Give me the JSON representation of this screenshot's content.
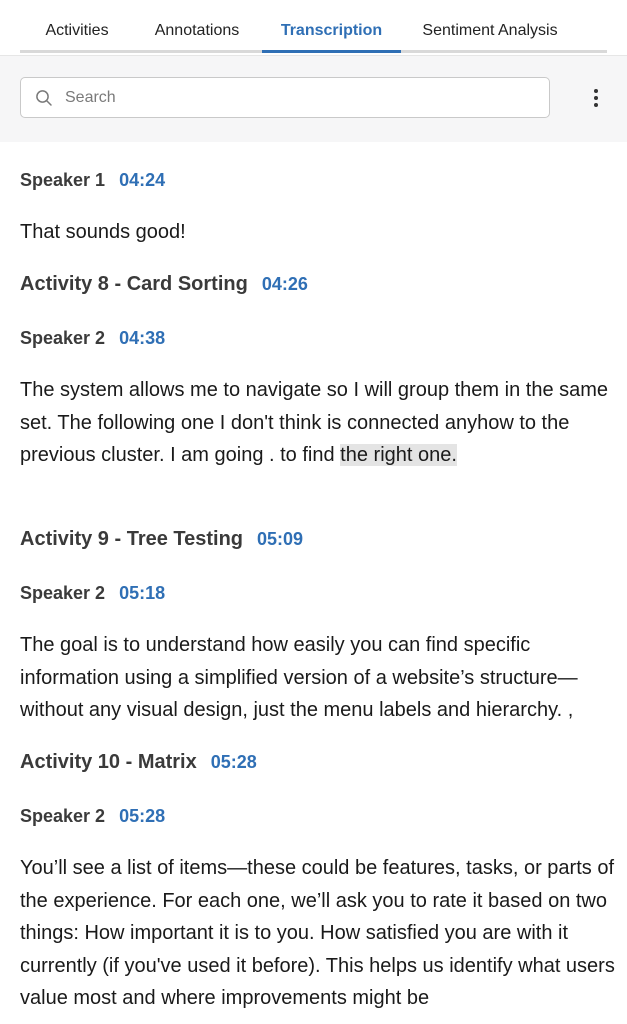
{
  "tabs": [
    {
      "label": "Activities",
      "active": false
    },
    {
      "label": "Annotations",
      "active": false
    },
    {
      "label": "Transcription",
      "active": true
    },
    {
      "label": "Sentiment Analysis",
      "active": false
    }
  ],
  "search": {
    "placeholder": "Search",
    "value": ""
  },
  "colors": {
    "accent": "#2f6fb5",
    "highlight": "#e4e4e4"
  },
  "icons": {
    "search": "search-icon",
    "more": "more-vertical-icon"
  },
  "transcript": [
    {
      "type": "speaker",
      "speaker": "Speaker 1",
      "time": "04:24",
      "text": "That sounds good!"
    },
    {
      "type": "activity",
      "title": "Activity 8 - Card Sorting",
      "time": "04:26"
    },
    {
      "type": "speaker",
      "speaker": "Speaker 2",
      "time": "04:38",
      "text_before": "The system allows me to navigate so I will group them in the same set. The following one I don't think is connected anyhow to the previous cluster. I am going . to find ",
      "highlighted": "the right one."
    },
    {
      "type": "activity",
      "title": "Activity 9 - Tree Testing",
      "time": "05:09"
    },
    {
      "type": "speaker",
      "speaker": "Speaker 2",
      "time": "05:18",
      "text": "The goal is to understand how easily you can find specific information using a simplified version of a website’s structure—without any visual design, just the menu labels and hierarchy. ,"
    },
    {
      "type": "activity",
      "title": "Activity 10 - Matrix",
      "time": "05:28"
    },
    {
      "type": "speaker",
      "speaker": "Speaker 2",
      "time": "05:28",
      "text": "You’ll see a list of items—these could be features, tasks, or parts of the experience. For each one, we’ll ask you to rate it based on two things: How important it is to you. How satisfied you are with it currently (if you've used it before). This helps us identify what users value most and where improvements might be"
    }
  ]
}
